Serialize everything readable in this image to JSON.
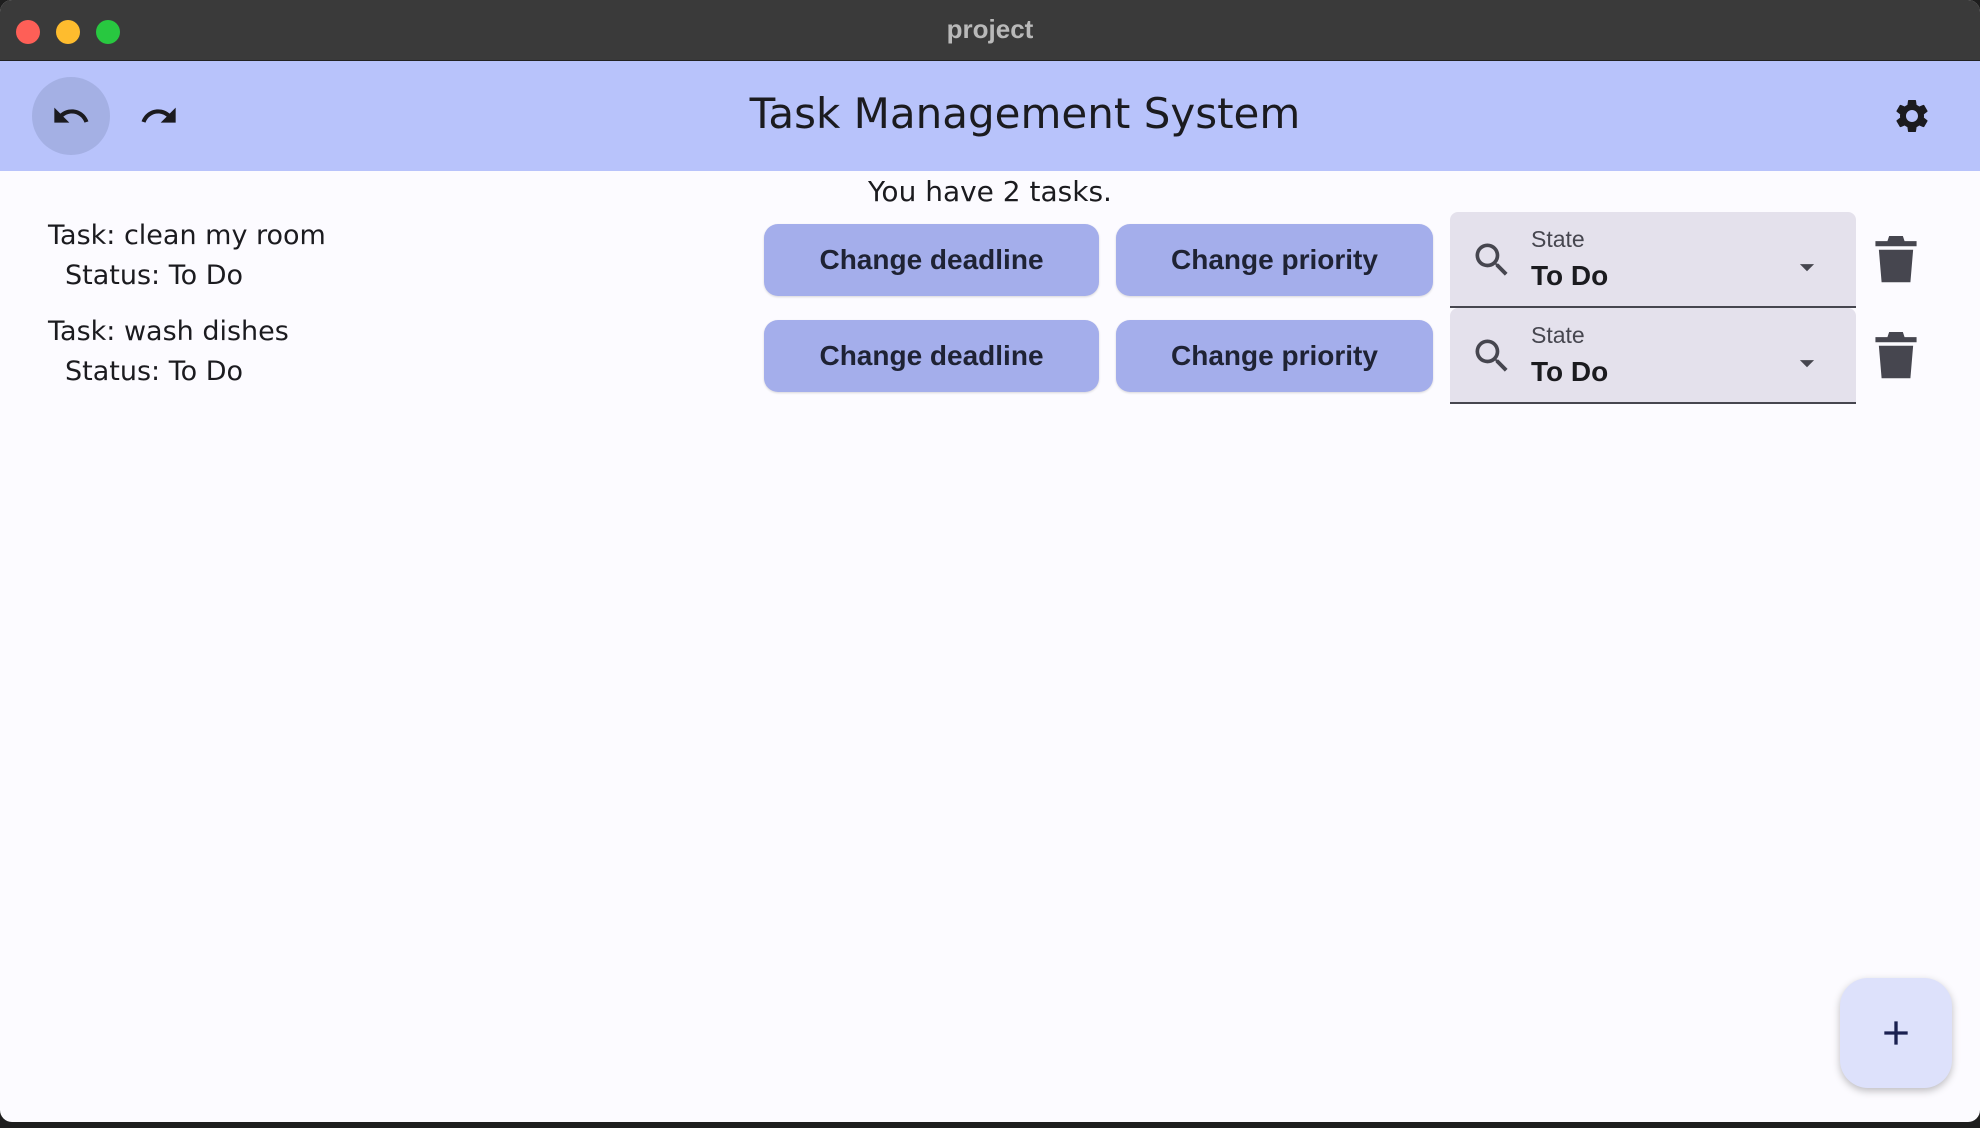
{
  "window": {
    "title": "project"
  },
  "appbar": {
    "title": "Task Management System",
    "undo_icon": "undo-icon",
    "redo_icon": "redo-icon",
    "settings_icon": "gear-icon"
  },
  "summary": "You have 2 tasks.",
  "tasks": [
    {
      "name": "Task: clean my room",
      "status": "Status: To Do",
      "deadline_label": "Change deadline",
      "priority_label": "Change priority",
      "state_label": "State",
      "state_value": "To Do"
    },
    {
      "name": "Task: wash dishes",
      "status": "Status: To Do",
      "deadline_label": "Change deadline",
      "priority_label": "Change priority",
      "state_label": "State",
      "state_value": "To Do"
    }
  ],
  "fab": {
    "icon": "plus-icon"
  },
  "colors": {
    "appbar_bg": "#b8c3fb",
    "button_bg": "#a4aeeb",
    "field_bg": "#e4e1ec",
    "fab_bg": "#dde1fb"
  }
}
